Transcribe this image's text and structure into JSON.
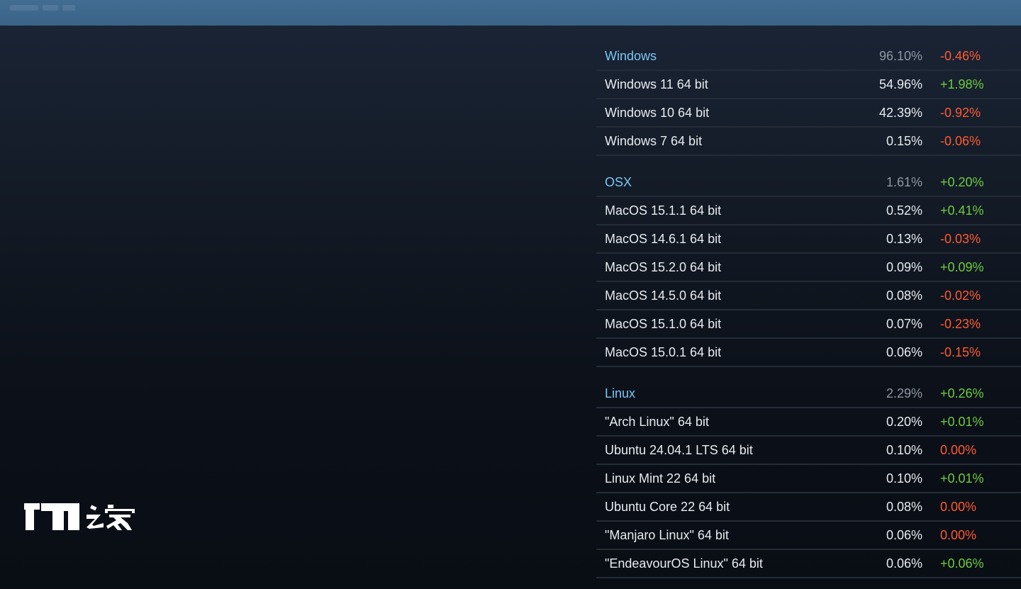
{
  "os_stats": {
    "windows": {
      "header": {
        "name": "Windows",
        "pct": "96.10%",
        "chg": "-0.46%",
        "dir": "neg"
      },
      "items": [
        {
          "name": "Windows 11 64 bit",
          "pct": "54.96%",
          "chg": "+1.98%",
          "dir": "pos"
        },
        {
          "name": "Windows 10 64 bit",
          "pct": "42.39%",
          "chg": "-0.92%",
          "dir": "neg"
        },
        {
          "name": "Windows 7 64 bit",
          "pct": "0.15%",
          "chg": "-0.06%",
          "dir": "neg"
        }
      ]
    },
    "osx": {
      "header": {
        "name": "OSX",
        "pct": "1.61%",
        "chg": "+0.20%",
        "dir": "pos"
      },
      "items": [
        {
          "name": "MacOS 15.1.1 64 bit",
          "pct": "0.52%",
          "chg": "+0.41%",
          "dir": "pos"
        },
        {
          "name": "MacOS 14.6.1 64 bit",
          "pct": "0.13%",
          "chg": "-0.03%",
          "dir": "neg"
        },
        {
          "name": "MacOS 15.2.0 64 bit",
          "pct": "0.09%",
          "chg": "+0.09%",
          "dir": "pos"
        },
        {
          "name": "MacOS 14.5.0 64 bit",
          "pct": "0.08%",
          "chg": "-0.02%",
          "dir": "neg"
        },
        {
          "name": "MacOS 15.1.0 64 bit",
          "pct": "0.07%",
          "chg": "-0.23%",
          "dir": "neg"
        },
        {
          "name": "MacOS 15.0.1 64 bit",
          "pct": "0.06%",
          "chg": "-0.15%",
          "dir": "neg"
        }
      ]
    },
    "linux": {
      "header": {
        "name": "Linux",
        "pct": "2.29%",
        "chg": "+0.26%",
        "dir": "pos"
      },
      "items": [
        {
          "name": "\"Arch Linux\" 64 bit",
          "pct": "0.20%",
          "chg": "+0.01%",
          "dir": "pos"
        },
        {
          "name": "Ubuntu 24.04.1 LTS 64 bit",
          "pct": "0.10%",
          "chg": "0.00%",
          "dir": "neg"
        },
        {
          "name": "Linux Mint 22 64 bit",
          "pct": "0.10%",
          "chg": "+0.01%",
          "dir": "pos"
        },
        {
          "name": "Ubuntu Core 22 64 bit",
          "pct": "0.08%",
          "chg": "0.00%",
          "dir": "neg"
        },
        {
          "name": "\"Manjaro Linux\" 64 bit",
          "pct": "0.06%",
          "chg": "0.00%",
          "dir": "neg"
        },
        {
          "name": "\"EndeavourOS Linux\" 64 bit",
          "pct": "0.06%",
          "chg": "+0.06%",
          "dir": "pos"
        }
      ]
    }
  },
  "watermark": {
    "text": "IT之家"
  },
  "colors": {
    "header_text": "#79c7f2",
    "positive": "#6ecb3f",
    "negative": "#ff5a31",
    "top_bar": "#3f6a8f",
    "background": "#0b1018"
  }
}
